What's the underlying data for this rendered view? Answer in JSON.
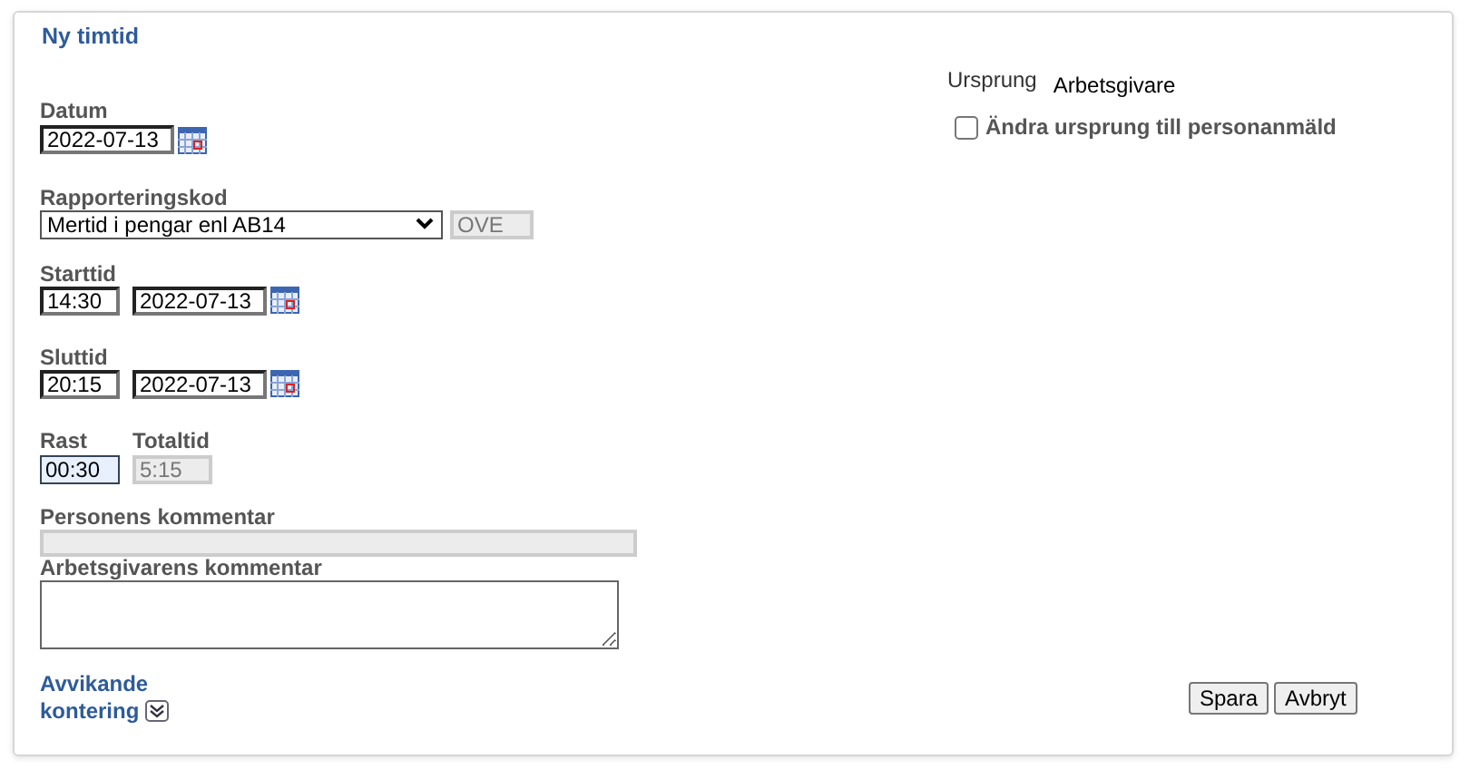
{
  "title": "Ny timtid",
  "datum": {
    "label": "Datum",
    "value": "2022-07-13",
    "disabled": false
  },
  "rapporteringskod": {
    "label": "Rapporteringskod",
    "value": "Mertid i pengar enl AB14",
    "code": "OVE",
    "code_disabled": true
  },
  "starttid": {
    "label": "Starttid",
    "time": "14:30",
    "date": "2022-07-13"
  },
  "sluttid": {
    "label": "Sluttid",
    "time": "20:15",
    "date": "2022-07-13"
  },
  "rast": {
    "label": "Rast",
    "value": "00:30",
    "disabled": false
  },
  "totaltid": {
    "label": "Totaltid",
    "value": "5:15",
    "disabled": true
  },
  "personens_kommentar": {
    "label": "Personens kommentar",
    "disabled": true
  },
  "arbetsgivarens_kommentar": {
    "label": "Arbetsgivarens kommentar",
    "disabled": false
  },
  "avvikande_kontering": {
    "label_lines": [
      "Avvikande",
      "kontering"
    ],
    "expanded": false
  },
  "ursprung": {
    "label": "Ursprung",
    "value": "Arbetsgivare"
  },
  "andra_ursprung": {
    "label": "Ändra ursprung till personanmäld",
    "checked": false
  },
  "buttons": [
    "Spara",
    "Avbryt"
  ]
}
